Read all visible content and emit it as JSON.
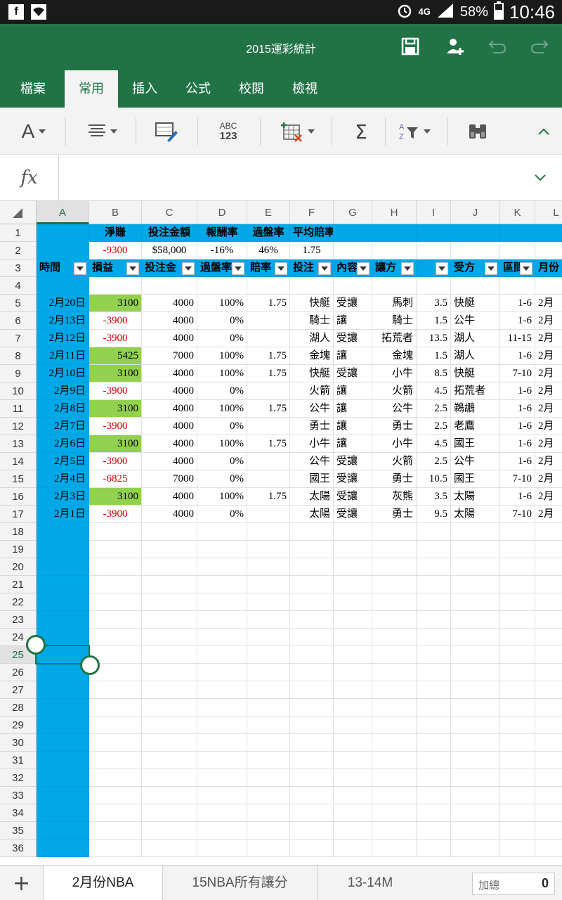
{
  "status_bar": {
    "network": "4G",
    "battery": "58%",
    "time": "10:46"
  },
  "document": {
    "title": "2015運彩統計"
  },
  "ribbon_tabs": [
    "檔案",
    "常用",
    "插入",
    "公式",
    "校閱",
    "檢視"
  ],
  "active_tab": "常用",
  "toolbar": {
    "font_label": "A",
    "sum_label": "Σ",
    "spell_label_top": "ABC",
    "spell_label_bottom": "123"
  },
  "formula_bar": {
    "fx_label": "fx",
    "content": ""
  },
  "grid": {
    "columns": [
      "A",
      "B",
      "C",
      "D",
      "E",
      "F",
      "G",
      "H",
      "I",
      "J",
      "K",
      "L"
    ],
    "rows": [
      "1",
      "2",
      "3",
      "4",
      "5",
      "6",
      "7",
      "8",
      "9",
      "10",
      "11",
      "12",
      "13",
      "14",
      "15",
      "16",
      "17",
      "18",
      "19",
      "20",
      "21",
      "22",
      "23",
      "24",
      "25",
      "26",
      "27",
      "28",
      "29",
      "30",
      "31",
      "32",
      "33",
      "34",
      "35",
      "36"
    ],
    "selected_column": "A",
    "selected_row": "25",
    "summary_headers": [
      "淨賺",
      "投注金額",
      "報酬率",
      "過盤率",
      "平均賠率"
    ],
    "summary_values": [
      "-9300",
      "$58,000",
      "-16%",
      "46%",
      "1.75"
    ],
    "table_headers": [
      "時間",
      "損益",
      "投注金",
      "過盤率",
      "賠率",
      "投注",
      "內容",
      "讓方",
      "",
      "受方",
      "區間",
      "月份"
    ],
    "table_rows": [
      [
        "2月20日",
        "3100",
        "4000",
        "100%",
        "1.75",
        "快艇",
        "受讓",
        "馬刺",
        "3.5",
        "快艇",
        "1-6",
        "2月"
      ],
      [
        "2月13日",
        "-3900",
        "4000",
        "0%",
        "",
        "騎士",
        "讓",
        "騎士",
        "1.5",
        "公牛",
        "1-6",
        "2月"
      ],
      [
        "2月12日",
        "-3900",
        "4000",
        "0%",
        "",
        "湖人",
        "受讓",
        "拓荒者",
        "13.5",
        "湖人",
        "11-15",
        "2月"
      ],
      [
        "2月11日",
        "5425",
        "7000",
        "100%",
        "1.75",
        "金塊",
        "讓",
        "金塊",
        "1.5",
        "湖人",
        "1-6",
        "2月"
      ],
      [
        "2月10日",
        "3100",
        "4000",
        "100%",
        "1.75",
        "快艇",
        "受讓",
        "小牛",
        "8.5",
        "快艇",
        "7-10",
        "2月"
      ],
      [
        "2月9日",
        "-3900",
        "4000",
        "0%",
        "",
        "火箭",
        "讓",
        "火箭",
        "4.5",
        "拓荒者",
        "1-6",
        "2月"
      ],
      [
        "2月8日",
        "3100",
        "4000",
        "100%",
        "1.75",
        "公牛",
        "讓",
        "公牛",
        "2.5",
        "鵜鶘",
        "1-6",
        "2月"
      ],
      [
        "2月7日",
        "-3900",
        "4000",
        "0%",
        "",
        "勇士",
        "讓",
        "勇士",
        "2.5",
        "老鷹",
        "1-6",
        "2月"
      ],
      [
        "2月6日",
        "3100",
        "4000",
        "100%",
        "1.75",
        "小牛",
        "讓",
        "小牛",
        "4.5",
        "國王",
        "1-6",
        "2月"
      ],
      [
        "2月5日",
        "-3900",
        "4000",
        "0%",
        "",
        "公牛",
        "受讓",
        "火箭",
        "2.5",
        "公牛",
        "1-6",
        "2月"
      ],
      [
        "2月4日",
        "-6825",
        "7000",
        "0%",
        "",
        "國王",
        "受讓",
        "勇士",
        "10.5",
        "國王",
        "7-10",
        "2月"
      ],
      [
        "2月3日",
        "3100",
        "4000",
        "100%",
        "1.75",
        "太陽",
        "受讓",
        "灰熊",
        "3.5",
        "太陽",
        "1-6",
        "2月"
      ],
      [
        "2月1日",
        "-3900",
        "4000",
        "0%",
        "",
        "太陽",
        "受讓",
        "勇士",
        "9.5",
        "太陽",
        "7-10",
        "2月"
      ]
    ]
  },
  "sheet_tabs": [
    "2月份NBA",
    "15NBA所有讓分",
    "13-14M"
  ],
  "active_sheet": "2月份NBA",
  "status_sum": {
    "label": "加總",
    "value": "0"
  },
  "colors": {
    "excel_green": "#217346",
    "highlight_blue": "#00a8e8",
    "profit_green": "#92d050",
    "loss_red": "#d00000"
  }
}
